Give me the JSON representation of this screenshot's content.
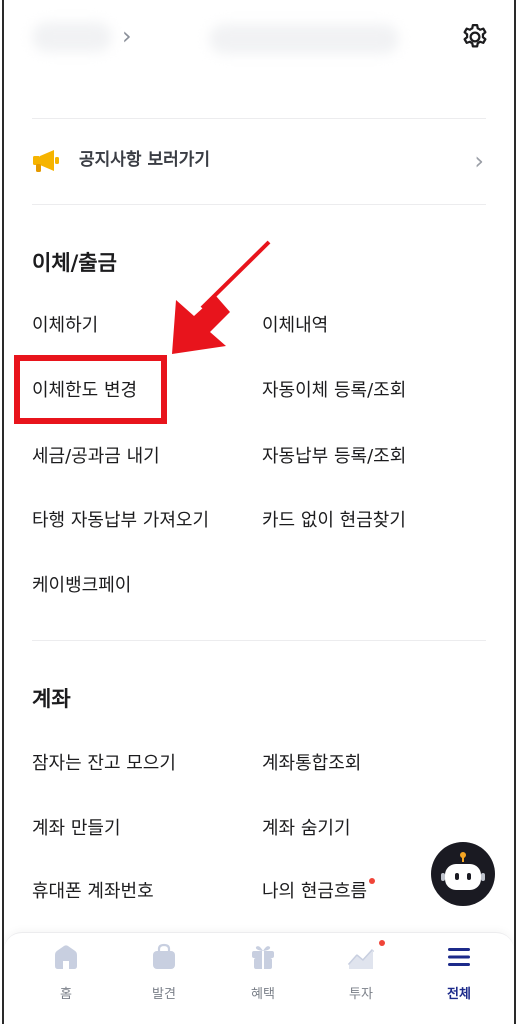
{
  "header": {
    "chevron": "›",
    "icons": {
      "settings": "gear-icon"
    }
  },
  "notice": {
    "label": "공지사항 보러가기",
    "icon": "megaphone-icon",
    "arrow": "›"
  },
  "transfer": {
    "title": "이체/출금",
    "items": [
      "이체하기",
      "이체내역",
      "이체한도 변경",
      "자동이체 등록/조회",
      "세금/공과금 내기",
      "자동납부 등록/조회",
      "타행 자동납부 가져오기",
      "카드 없이 현금찾기",
      "케이뱅크페이"
    ]
  },
  "account": {
    "title": "계좌",
    "items": [
      "잠자는 잔고 모으기",
      "계좌통합조회",
      "계좌 만들기",
      "계좌 숨기기",
      "휴대폰 계좌번호",
      "나의 현금흐름"
    ]
  },
  "bottom_nav": {
    "items": [
      {
        "label": "홈",
        "icon": "home-icon"
      },
      {
        "label": "발견",
        "icon": "shopping-bag-icon"
      },
      {
        "label": "혜택",
        "icon": "gift-icon"
      },
      {
        "label": "투자",
        "icon": "chart-icon"
      },
      {
        "label": "전체",
        "icon": "menu-icon"
      }
    ],
    "active": "전체"
  },
  "colors": {
    "accent": "#1c2a8a",
    "highlight": "#e8141c",
    "notification": "#f04438",
    "megaphone": "#f6b400"
  }
}
